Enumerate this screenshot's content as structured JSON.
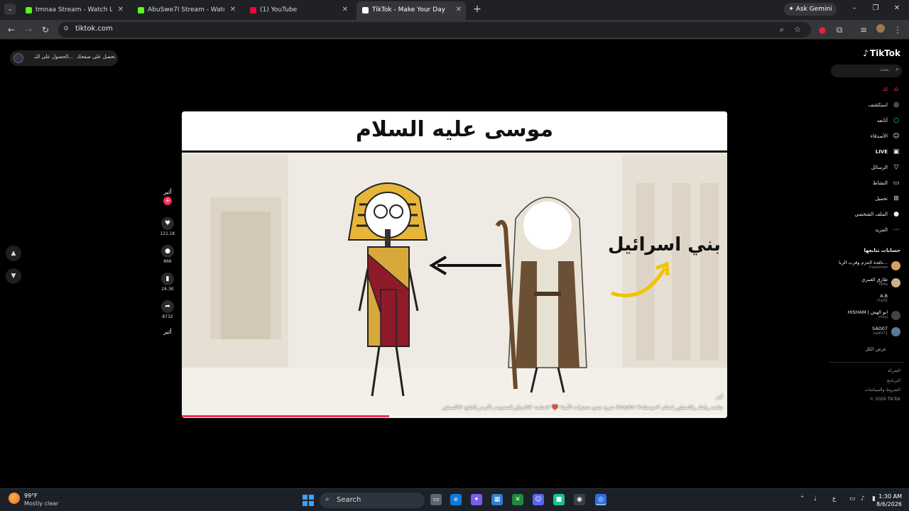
{
  "browser": {
    "tabs": [
      {
        "title": "tmnaa Stream - Watch Live on K",
        "favicon_color": "#53fc18"
      },
      {
        "title": "AbuSwe7l Stream - Watch Live",
        "favicon_color": "#53fc18"
      },
      {
        "title": "(1) YouTube",
        "favicon_color": "#ff0033"
      },
      {
        "title": "TikTok - Make Your Day",
        "favicon_color": "#ffffff",
        "active": true
      }
    ],
    "ask_gemini": "Ask Gemini",
    "url": "tiktok.com"
  },
  "page": {
    "extension_pill": {
      "text_left": "الحصول على التـ...",
      "text_right": "نحصل على صفحك"
    },
    "video": {
      "banner_title": "موسى عليه السلام",
      "scene_label": "بني اسرائيل",
      "author": "أثير",
      "caption": "شرح جميع معجزات الأنبياء ❤️ #متابعة #العراق_السعوديه_الاردن_الخليج #اكسبلور #explor #متابعه_واتيك_واكسبلور_احبكم #موعظة",
      "progress_fraction": 0.38
    },
    "actions": {
      "author_label": "أثير",
      "likes": "121.1K",
      "comments": "866",
      "saves": "24.3K",
      "shares": "8732",
      "bottom_label": "أثير"
    }
  },
  "sidebar": {
    "logo": "TikTok",
    "search_placeholder": "بحث",
    "nav": [
      {
        "label": "لك",
        "icon": "home-icon"
      },
      {
        "label": "استكشف",
        "icon": "compass-icon"
      },
      {
        "label": "أتابعه",
        "icon": "following-icon"
      },
      {
        "label": "الأصدقاء",
        "icon": "friends-icon"
      },
      {
        "label": "LIVE",
        "icon": "live-icon"
      },
      {
        "label": "الرسائل",
        "icon": "send-icon"
      },
      {
        "label": "النشاط",
        "icon": "inbox-icon"
      },
      {
        "label": "تحميل",
        "icon": "upload-icon"
      },
      {
        "label": "الملف الشخصي",
        "icon": "profile-icon"
      },
      {
        "label": "المزيد",
        "icon": "more-icon"
      }
    ],
    "following_header": "حسابات تتابعها",
    "accounts": [
      {
        "name": "نافذة الحرم وقرب الربا...",
        "handle": "hazamws"
      },
      {
        "name": "طارق الغمري",
        "handle": "t94a"
      },
      {
        "name": "A.B",
        "handle": "l7a35"
      },
      {
        "name": "HISHAM | ابو الهش",
        "handle": "_msyj"
      },
      {
        "name": "SAD07",
        "handle": "sad071"
      }
    ],
    "see_all": "عرض الكل",
    "footer": [
      "الشركة",
      "البرنامج",
      "الشروط والسياسات",
      "© 2026 TikTok"
    ]
  },
  "taskbar": {
    "temperature": "99°F",
    "condition": "Mostly clear",
    "search_label": "Search",
    "time": "1:30 AM",
    "date": "8/6/2026"
  }
}
